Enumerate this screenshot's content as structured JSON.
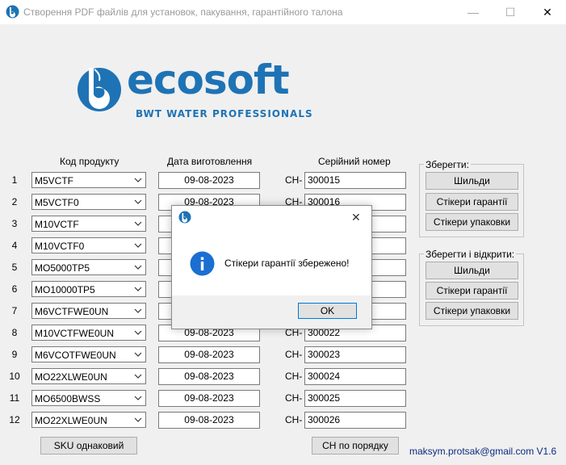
{
  "window": {
    "title": "Створення PDF файлів для установок, пакування, гарантійного талона",
    "minimize_glyph": "—",
    "maximize_glyph": "☐",
    "close_glyph": "✕"
  },
  "logo": {
    "brand": "ecosoft",
    "tagline": "BWT WATER PROFESSIONALS",
    "color": "#1e73b5"
  },
  "headers": {
    "product_code": "Код продукту",
    "manufacture_date": "Дата виготовлення",
    "serial_number": "Серійний номер"
  },
  "serial_prefix": "CH-",
  "rows": [
    {
      "num": "1",
      "product": "M5VCTF",
      "date": "09-08-2023",
      "serial": "300015"
    },
    {
      "num": "2",
      "product": "M5VCTF0",
      "date": "09-08-2023",
      "serial": "300016"
    },
    {
      "num": "3",
      "product": "M10VCTF",
      "date": "",
      "serial": ""
    },
    {
      "num": "4",
      "product": "M10VCTF0",
      "date": "",
      "serial": ""
    },
    {
      "num": "5",
      "product": "MO5000TP5",
      "date": "",
      "serial": ""
    },
    {
      "num": "6",
      "product": "MO10000TP5",
      "date": "",
      "serial": ""
    },
    {
      "num": "7",
      "product": "M6VCTFWE0UN",
      "date": "",
      "serial": ""
    },
    {
      "num": "8",
      "product": "M10VCTFWE0UN",
      "date": "09-08-2023",
      "serial": "300022"
    },
    {
      "num": "9",
      "product": "M6VCOTFWE0UN",
      "date": "09-08-2023",
      "serial": "300023"
    },
    {
      "num": "10",
      "product": "MO22XLWE0UN",
      "date": "09-08-2023",
      "serial": "300024"
    },
    {
      "num": "11",
      "product": "MO6500BWSS",
      "date": "09-08-2023",
      "serial": "300025"
    },
    {
      "num": "12",
      "product": "MO22XLWE0UN",
      "date": "09-08-2023",
      "serial": "300026"
    }
  ],
  "save_group": {
    "title": "Зберегти:",
    "labels": "Шильди",
    "warranty_stickers": "Стікери гарантії",
    "packaging_stickers": "Стікери упаковки"
  },
  "save_open_group": {
    "title": "Зберегти і відкрити:",
    "labels": "Шильди",
    "warranty_stickers": "Стікери гарантії",
    "packaging_stickers": "Стікери упаковки"
  },
  "bottom": {
    "sku_same": "SKU однаковий",
    "ch_sequential": "CH по порядку",
    "footer": "maksym.protsak@gmail.com V1.6"
  },
  "dialog": {
    "message": "Стікери гарантії збережено!",
    "ok": "OK",
    "close_glyph": "✕",
    "icon": "info-icon"
  }
}
